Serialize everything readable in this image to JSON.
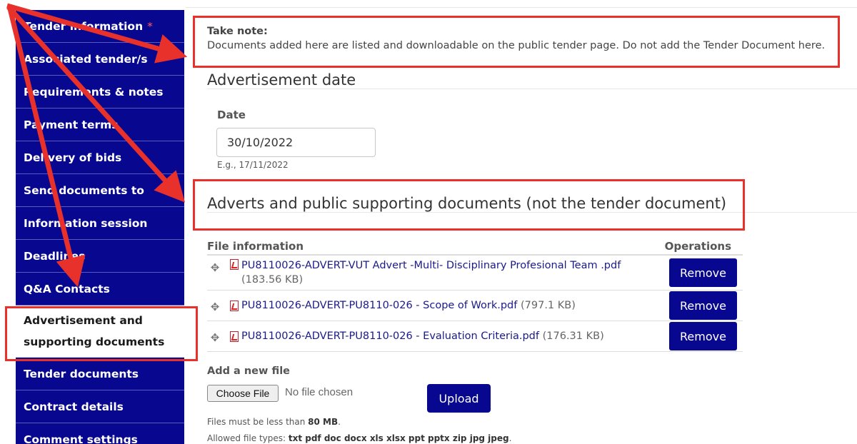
{
  "sidebar": {
    "items": [
      {
        "label": "Tender information",
        "required_mark": "*"
      },
      {
        "label": "Associated tender/s"
      },
      {
        "label": "Requirements & notes"
      },
      {
        "label": "Payment terms"
      },
      {
        "label": "Delivery of bids"
      },
      {
        "label": "Send documents to"
      },
      {
        "label": "Information session"
      },
      {
        "label": "Deadlines"
      },
      {
        "label": "Q&A Contacts"
      },
      {
        "label": "Advertisement and supporting documents",
        "active": true
      },
      {
        "label": "Tender documents"
      },
      {
        "label": "Contract details"
      },
      {
        "label": "Comment settings"
      }
    ]
  },
  "note": {
    "title": "Take note:",
    "text": "Documents added here are listed and downloadable on the public tender page. Do not add the Tender Document here."
  },
  "advertisement_date": {
    "heading": "Advertisement date",
    "date_label": "Date",
    "date_value": "30/10/2022",
    "hint": "E.g., 17/11/2022"
  },
  "documents": {
    "heading": "Adverts and public supporting documents (not the tender document)",
    "col_file": "File information",
    "col_ops": "Operations",
    "files": [
      {
        "name": "PU8110026-ADVERT-VUT Advert -Multi- Disciplinary Profesional Team .pdf",
        "size": "(183.56 KB)"
      },
      {
        "name": "PU8110026-ADVERT-PU8110-026 - Scope of Work.pdf",
        "size": "(797.1 KB)"
      },
      {
        "name": "PU8110026-ADVERT-PU8110-026 - Evaluation Criteria.pdf",
        "size": "(176.31 KB)"
      }
    ],
    "remove_label": "Remove"
  },
  "upload": {
    "label": "Add a new file",
    "choose_label": "Choose File",
    "no_file": "No file chosen",
    "upload_label": "Upload",
    "size_prefix": "Files must be less than ",
    "size_limit": "80 MB",
    "size_suffix": ".",
    "types_prefix": "Allowed file types: ",
    "types": "txt pdf doc docx xls xlsx ppt pptx zip jpg jpeg",
    "types_suffix": "."
  },
  "colors": {
    "nav_bg": "#07078f",
    "annotation_red": "#e8312b"
  }
}
